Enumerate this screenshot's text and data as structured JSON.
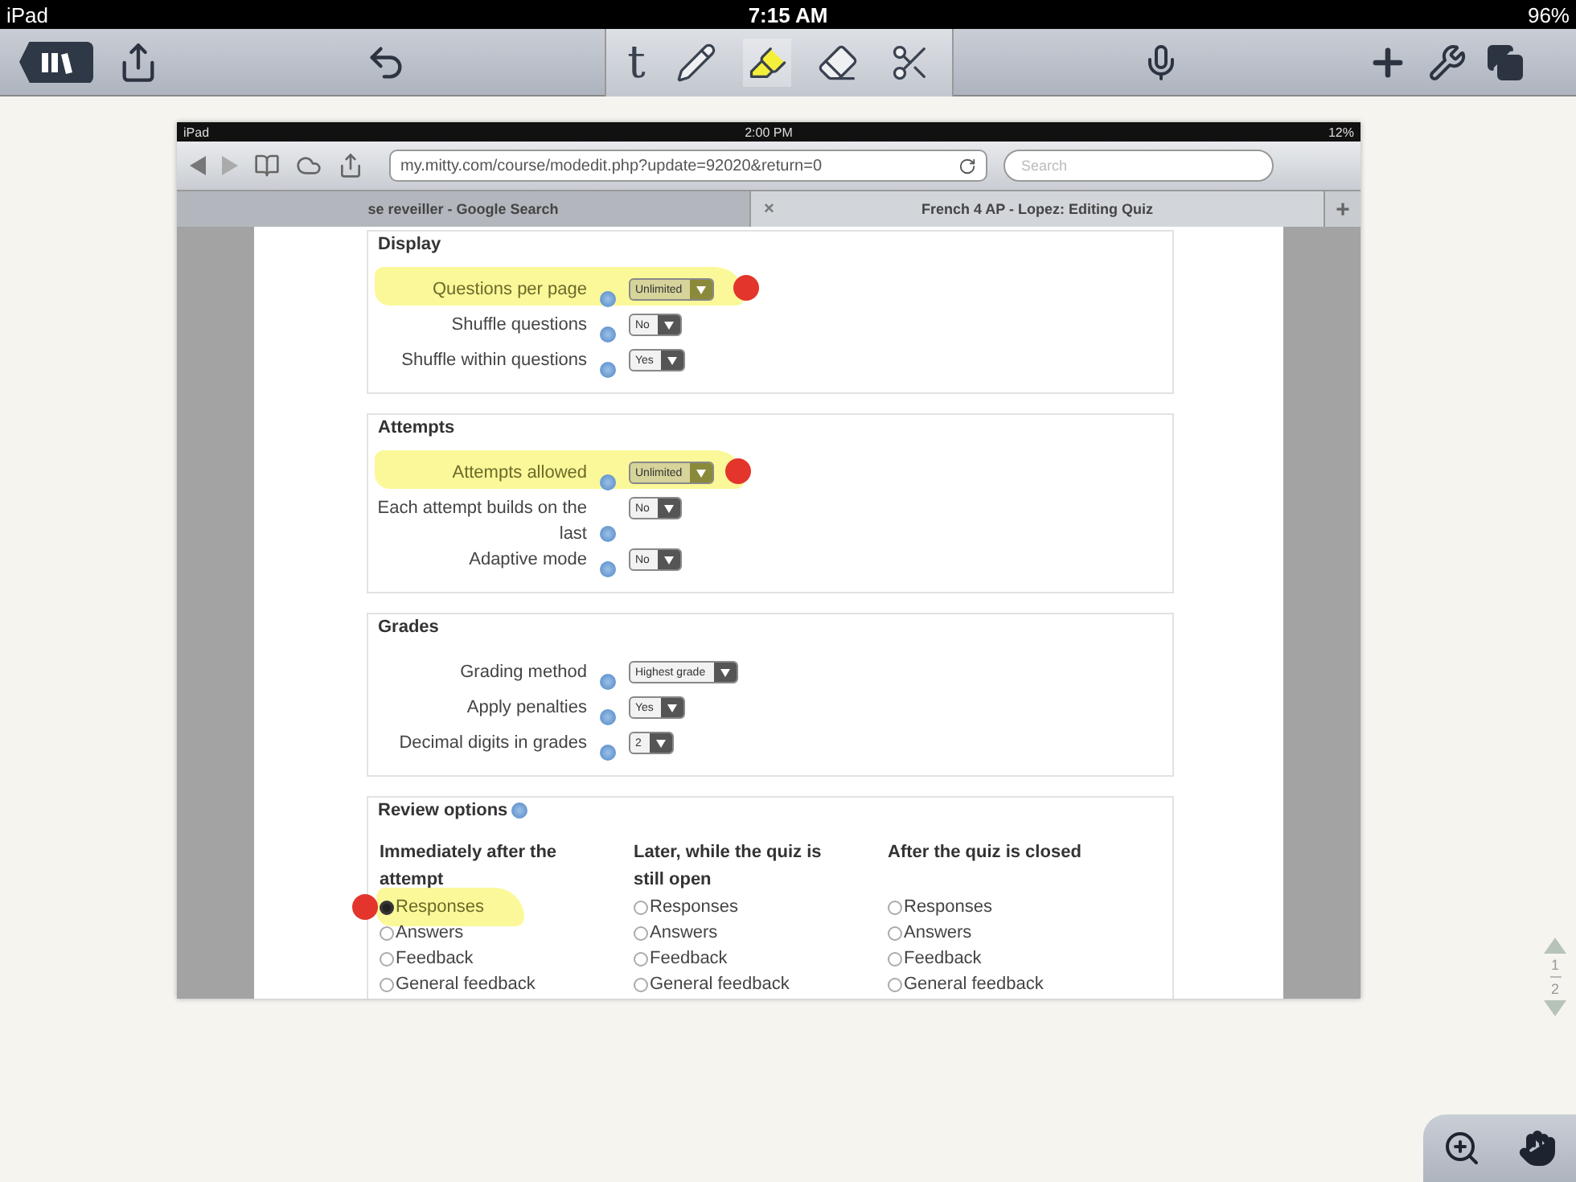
{
  "status_bar": {
    "device": "iPad",
    "time": "7:15 AM",
    "battery": "96%"
  },
  "toolbar": {
    "tools": [
      {
        "kind": "text",
        "glyph": "t",
        "selected": false
      },
      {
        "kind": "pencil",
        "selected": false
      },
      {
        "kind": "highlighter",
        "selected": true
      },
      {
        "kind": "eraser",
        "selected": false
      },
      {
        "kind": "scissors",
        "selected": false
      }
    ]
  },
  "document": {
    "status_bar": {
      "device": "iPad",
      "time": "2:00 PM",
      "battery": "12%"
    },
    "address": "my.mitty.com/course/modedit.php?update=92020&return=0",
    "search": {
      "placeholder": "Search"
    },
    "tabs": [
      {
        "label": "se reveiller - Google Search",
        "selected": false
      },
      {
        "label": "French 4 AP - Lopez: Editing Quiz",
        "selected": true,
        "close": "×"
      }
    ],
    "new_tab": "+",
    "sections": [
      {
        "legend": "Display",
        "rows": [
          {
            "label": "Questions per page",
            "value": "Unlimited",
            "highlighted": true,
            "marked": true
          },
          {
            "label": "Shuffle questions",
            "value": "No",
            "highlighted": false,
            "marked": false
          },
          {
            "label": "Shuffle within questions",
            "value": "Yes",
            "highlighted": false,
            "marked": false
          }
        ]
      },
      {
        "legend": "Attempts",
        "rows": [
          {
            "label": "Attempts allowed",
            "value": "Unlimited",
            "highlighted": true,
            "marked": true
          },
          {
            "label": "Each attempt builds on the last",
            "value": "No",
            "highlighted": false,
            "marked": false
          },
          {
            "label": "Adaptive mode",
            "value": "No",
            "highlighted": false,
            "marked": false
          }
        ]
      },
      {
        "legend": "Grades",
        "rows": [
          {
            "label": "Grading method",
            "value": "Highest grade",
            "highlighted": false,
            "marked": false
          },
          {
            "label": "Apply penalties",
            "value": "Yes",
            "highlighted": false,
            "marked": false
          },
          {
            "label": "Decimal digits in grades",
            "value": "2",
            "highlighted": false,
            "marked": false
          }
        ]
      }
    ],
    "review": {
      "legend": "Review options",
      "columns": [
        {
          "heading": "Immediately after the attempt",
          "options": [
            {
              "label": "Responses",
              "checked": true,
              "highlighted": true,
              "marked": true
            },
            {
              "label": "Answers",
              "checked": false,
              "highlighted": false,
              "marked": false
            },
            {
              "label": "Feedback",
              "checked": false,
              "highlighted": false,
              "marked": false
            },
            {
              "label": "General feedback",
              "checked": false,
              "highlighted": false,
              "marked": false
            }
          ]
        },
        {
          "heading": "Later, while the quiz is still open",
          "options": [
            {
              "label": "Responses",
              "checked": false,
              "highlighted": false,
              "marked": false
            },
            {
              "label": "Answers",
              "checked": false,
              "highlighted": false,
              "marked": false
            },
            {
              "label": "Feedback",
              "checked": false,
              "highlighted": false,
              "marked": false
            },
            {
              "label": "General feedback",
              "checked": false,
              "highlighted": false,
              "marked": false
            }
          ]
        },
        {
          "heading": "After the quiz is closed",
          "options": [
            {
              "label": "Responses",
              "checked": false,
              "highlighted": false,
              "marked": false
            },
            {
              "label": "Answers",
              "checked": false,
              "highlighted": false,
              "marked": false
            },
            {
              "label": "Feedback",
              "checked": false,
              "highlighted": false,
              "marked": false
            },
            {
              "label": "General feedback",
              "checked": false,
              "highlighted": false,
              "marked": false
            }
          ]
        }
      ]
    }
  },
  "pager": {
    "current": "1",
    "total": "2"
  }
}
